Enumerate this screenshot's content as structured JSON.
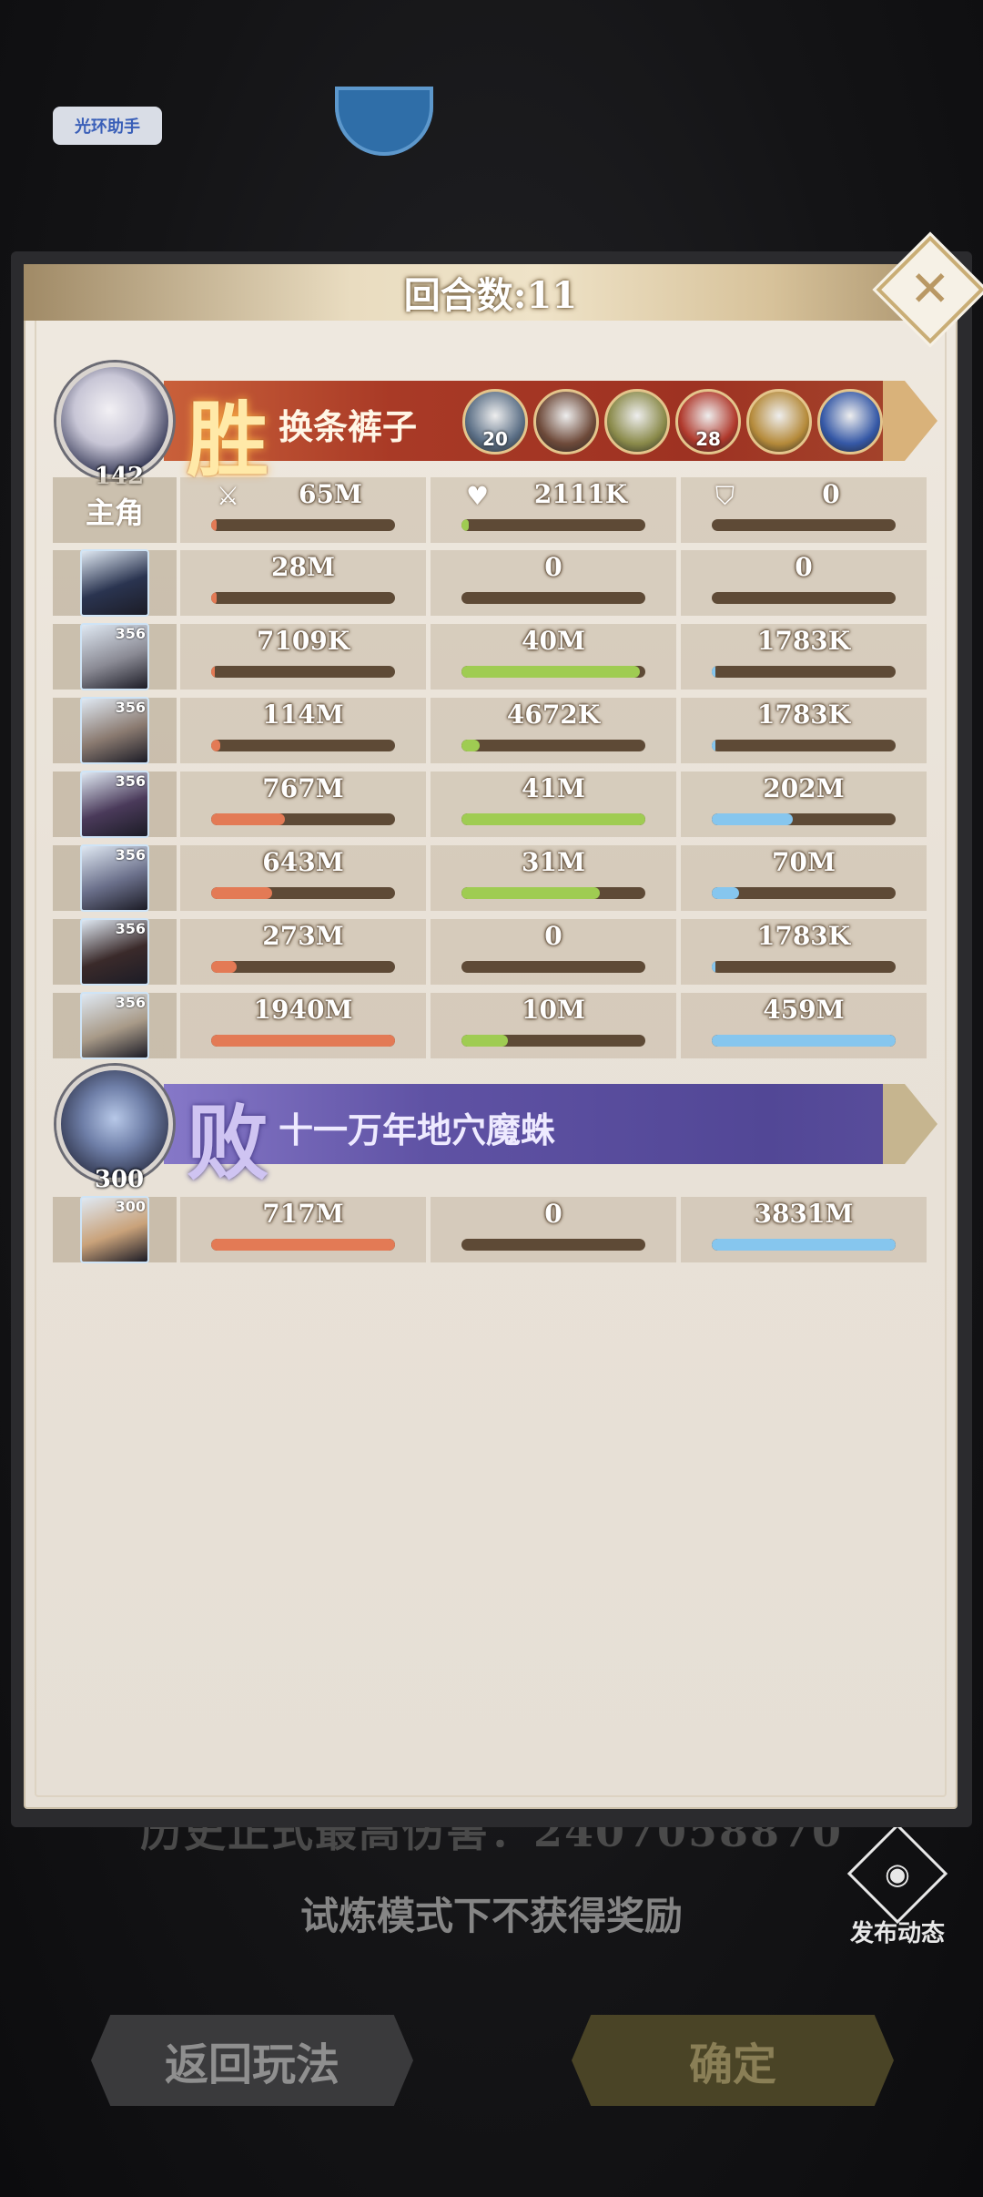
{
  "background": {
    "top_button": "光环助手",
    "history_text": "历史正式最高伤害：2407058870",
    "notice_text": "试炼模式下不获得奖励",
    "back_button": "返回玩法",
    "confirm_button": "确定",
    "publish_label": "发布动态",
    "publish_icon": "camera-icon"
  },
  "dialog": {
    "title": "回合数:11",
    "close_icon": "close-icon"
  },
  "winner": {
    "result": "胜",
    "name": "换条裤子",
    "level": "142",
    "main_label": "主角",
    "skills": [
      {
        "icon": "ice-blade-icon",
        "count": "20",
        "color": "#5b6f86"
      },
      {
        "icon": "spear-icon",
        "count": "",
        "color": "#6e4a3a"
      },
      {
        "icon": "lotus-icon",
        "count": "",
        "color": "#8a8a4a"
      },
      {
        "icon": "spiral-icon",
        "count": "28",
        "color": "#b0392c"
      },
      {
        "icon": "golden-wing-icon",
        "count": "",
        "color": "#b58a3a"
      },
      {
        "icon": "blue-flower-icon",
        "count": "",
        "color": "#3558a6"
      }
    ],
    "main_row": {
      "damage": "65M",
      "heal": "2111K",
      "defense": "0",
      "damage_pct": 3,
      "heal_pct": 4,
      "defense_pct": 0
    },
    "members": [
      {
        "level": "",
        "damage": "28M",
        "heal": "0",
        "defense": "0",
        "damage_pct": 1,
        "heal_pct": 0,
        "defense_pct": 0,
        "color": "#2a3450"
      },
      {
        "level": "356",
        "damage": "7109K",
        "heal": "40M",
        "defense": "1783K",
        "damage_pct": 0,
        "heal_pct": 97,
        "defense_pct": 0,
        "color": "#8a8a94"
      },
      {
        "level": "356",
        "damage": "114M",
        "heal": "4672K",
        "defense": "1783K",
        "damage_pct": 5,
        "heal_pct": 10,
        "defense_pct": 0,
        "color": "#8a7a70"
      },
      {
        "level": "356",
        "damage": "767M",
        "heal": "41M",
        "defense": "202M",
        "damage_pct": 40,
        "heal_pct": 100,
        "defense_pct": 44,
        "color": "#4a3a5a"
      },
      {
        "level": "356",
        "damage": "643M",
        "heal": "31M",
        "defense": "70M",
        "damage_pct": 33,
        "heal_pct": 75,
        "defense_pct": 15,
        "color": "#6a6f8a"
      },
      {
        "level": "356",
        "damage": "273M",
        "heal": "0",
        "defense": "1783K",
        "damage_pct": 14,
        "heal_pct": 0,
        "defense_pct": 0,
        "color": "#3a2a2a"
      },
      {
        "level": "356",
        "damage": "1940M",
        "heal": "10M",
        "defense": "459M",
        "damage_pct": 100,
        "heal_pct": 25,
        "defense_pct": 100,
        "color": "#a89a88"
      }
    ]
  },
  "loser": {
    "result": "败",
    "name": "十一万年地穴魔蛛",
    "level": "300",
    "members": [
      {
        "level": "300",
        "damage": "717M",
        "heal": "0",
        "defense": "3831M",
        "damage_pct": 100,
        "heal_pct": 0,
        "defense_pct": 100,
        "color": "#c9a27a"
      }
    ]
  }
}
